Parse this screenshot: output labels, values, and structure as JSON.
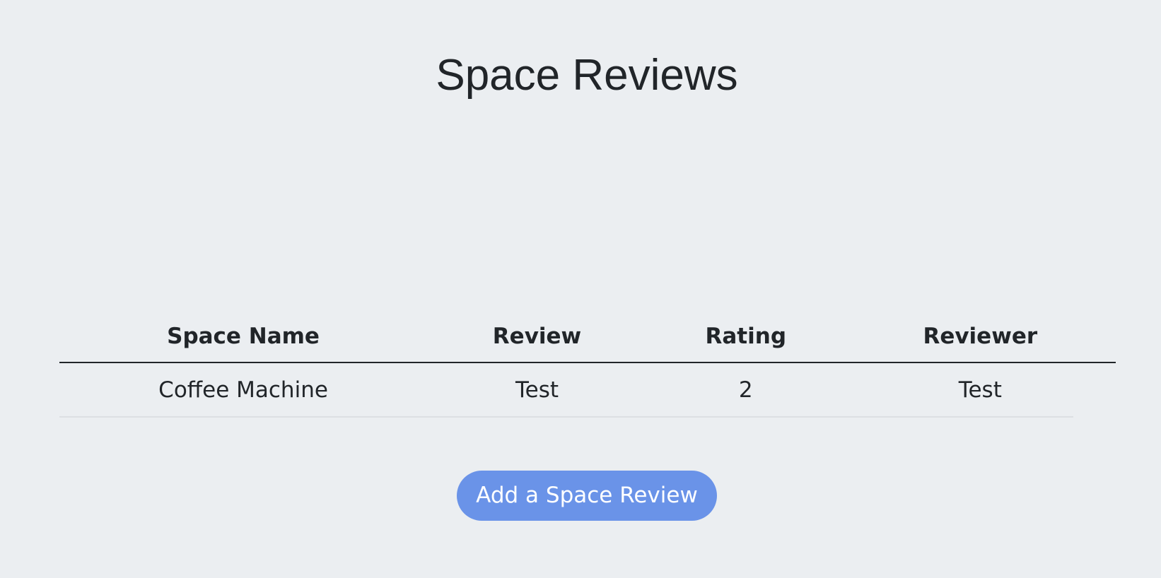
{
  "page": {
    "title": "Space Reviews"
  },
  "table": {
    "headers": [
      "Space Name",
      "Review",
      "Rating",
      "Reviewer"
    ],
    "rows": [
      [
        "Coffee Machine",
        "Test",
        "2",
        "Test"
      ]
    ]
  },
  "actions": {
    "add_review_label": "Add a Space Review"
  },
  "colors": {
    "background": "#ebeef1",
    "text": "#212529",
    "button": "#6a93e8",
    "button_text": "#ffffff"
  }
}
